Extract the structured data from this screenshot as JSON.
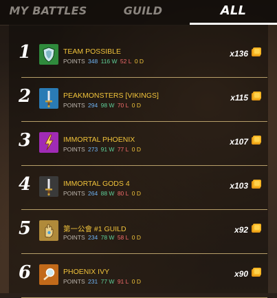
{
  "tabs": [
    {
      "label": "MY BATTLES",
      "active": false
    },
    {
      "label": "GUILD",
      "active": false
    },
    {
      "label": "ALL",
      "active": true
    }
  ],
  "leaderboard": [
    {
      "rank": "1",
      "name": "TEAM POSSIBLE",
      "points_label": "POINTS",
      "points": "348",
      "wins": "116 W",
      "losses": "52 L",
      "draws": "0 D",
      "reward": "x136",
      "emblem": "shield-icon",
      "emblem_color": "#2f8a3c"
    },
    {
      "rank": "2",
      "name": "PEAKMONSTERS [VIKINGS]",
      "points_label": "POINTS",
      "points": "294",
      "wins": "98 W",
      "losses": "70 L",
      "draws": "0 D",
      "reward": "x115",
      "emblem": "sword-icon",
      "emblem_color": "#2a7bb5"
    },
    {
      "rank": "3",
      "name": "IMMORTAL PHOENIX",
      "points_label": "POINTS",
      "points": "273",
      "wins": "91 W",
      "losses": "77 L",
      "draws": "0 D",
      "reward": "x107",
      "emblem": "lightning-icon",
      "emblem_color": "#a02bb5"
    },
    {
      "rank": "4",
      "name": "IMMORTAL GODS 4",
      "points_label": "POINTS",
      "points": "264",
      "wins": "88 W",
      "losses": "80 L",
      "draws": "0 D",
      "reward": "x103",
      "emblem": "sword-icon",
      "emblem_color": "#3a3a3a"
    },
    {
      "rank": "5",
      "name": "第一公會 #1 GUILD",
      "points_label": "POINTS",
      "points": "234",
      "wins": "78 W",
      "losses": "58 L",
      "draws": "0 D",
      "reward": "x92",
      "emblem": "hand-icon",
      "emblem_color": "#b08a3a"
    },
    {
      "rank": "6",
      "name": "PHOENIX IVY",
      "points_label": "POINTS",
      "points": "231",
      "wins": "77 W",
      "losses": "91 L",
      "draws": "0 D",
      "reward": "x90",
      "emblem": "magnifier-icon",
      "emblem_color": "#c26a1a"
    }
  ],
  "colors": {
    "name": "#f2c43b",
    "points": "#6fb4f5",
    "wins": "#5fd09a",
    "losses": "#f26b6b",
    "draws": "#f2c43b",
    "divider": "#b8a06a",
    "coin": "#f2a31b"
  }
}
